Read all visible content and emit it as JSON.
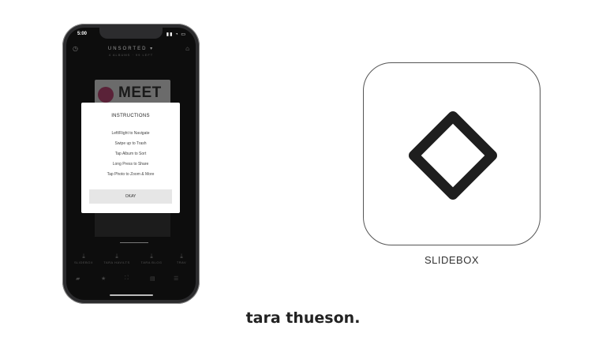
{
  "phone": {
    "status_time": "5:00",
    "status_icons": "▮▮ ◔ ▭",
    "app_title": "UNSORTED ▾",
    "app_subtitle": "4 ALBUMS · 99 LEFT",
    "photo_text": "MEET",
    "modal": {
      "title": "INSTRUCTIONS",
      "lines": [
        "Left/Right to Navigate",
        "Swipe up to Trash",
        "Tap Album to Sort",
        "Long Press to Share",
        "Tap Photo to Zoom & More"
      ],
      "button": "OKAY"
    },
    "albums": [
      {
        "label": "SLIDEBOX",
        "icon": "download-icon"
      },
      {
        "label": "TARA HAVILTS",
        "icon": "download-icon"
      },
      {
        "label": "TARA BLOG",
        "icon": "download-icon"
      },
      {
        "label": "TRAV",
        "icon": "download-icon"
      }
    ],
    "tabs": [
      "▰",
      "★",
      "⛶",
      "▤",
      "☰"
    ]
  },
  "app_icon": {
    "name": "SLIDEBOX",
    "icon": "diamond-icon"
  },
  "credit": "tara thueson."
}
